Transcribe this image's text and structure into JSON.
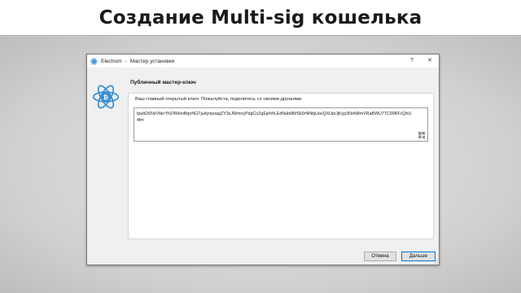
{
  "slide": {
    "title": "Создание Multi-sig кошелька"
  },
  "window": {
    "app_name": "Electrum",
    "title_separator": "-",
    "subtitle": "Мастер установки",
    "help_label": "?",
    "close_label": "✕"
  },
  "page": {
    "heading": "Публичный мастер-ключ",
    "instruction": "Ваш главный открытый ключ. Пожалуйста, поделитесь со своими друзьями.",
    "master_public_key": "tpubD6NzVbkrYhZ4WonBqnNGTjudynpoagZY3sJWmnyPdgCoZgEjehhLEdNabi8MSk9rNNbjUavQXUpiJjKyp3NeN8mVRaBWU7TC99RFcQhU4fm"
  },
  "buttons": {
    "cancel": "Отмена",
    "next": "Дальше"
  },
  "colors": {
    "electrum_blue": "#3a8fd0",
    "primary_border": "#0078d7"
  },
  "icons": {
    "app": "electrum-logo-icon",
    "qr": "qr-code-icon"
  }
}
